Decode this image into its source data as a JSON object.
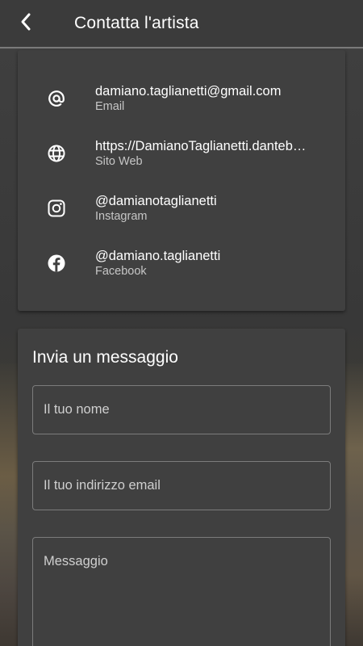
{
  "header": {
    "title": "Contatta l'artista",
    "back_icon": "chevron-left-icon"
  },
  "contacts": [
    {
      "icon": "at-icon",
      "value": "damiano.taglianetti@gmail.com",
      "label": "Email"
    },
    {
      "icon": "globe-icon",
      "value": "https://DamianoTaglianetti.danteb…",
      "label": "Sito Web"
    },
    {
      "icon": "instagram-icon",
      "value": "@damianotaglianetti",
      "label": "Instagram"
    },
    {
      "icon": "facebook-icon",
      "value": "@damiano.taglianetti",
      "label": "Facebook"
    }
  ],
  "message_form": {
    "title": "Invia un messaggio",
    "name_placeholder": "Il tuo nome",
    "email_placeholder": "Il tuo indirizzo email",
    "message_placeholder": "Messaggio"
  },
  "colors": {
    "appbar": "#3b3b3b",
    "card": "#404040",
    "text_primary": "#ffffff",
    "text_secondary": "#c6c6c6",
    "field_border": "#7c7c7c"
  }
}
